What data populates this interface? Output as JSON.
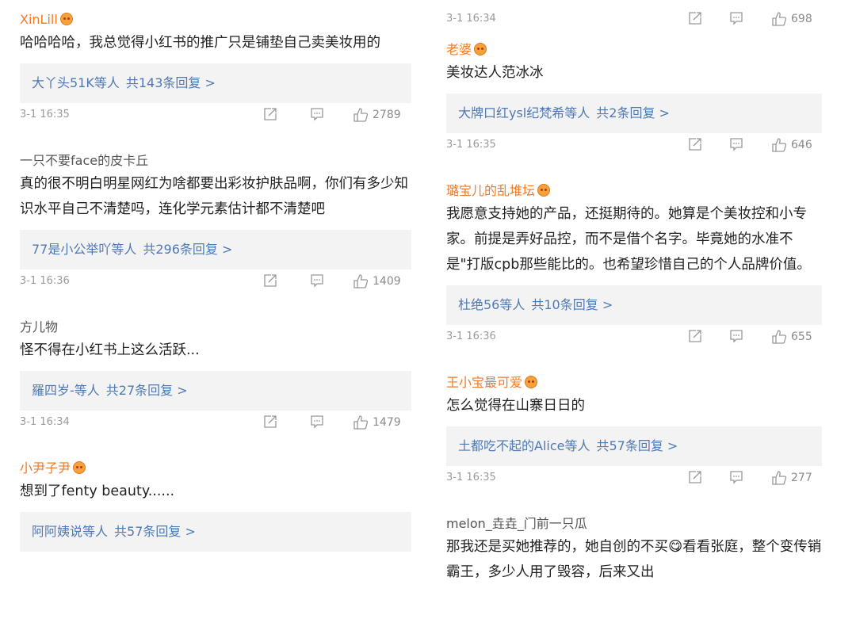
{
  "left": [
    {
      "user": "XinLill",
      "vip": true,
      "text": "哈哈哈哈，我总觉得小红书的推广只是铺垫自己卖美妆用的",
      "reply_names": "大丫头51K等人",
      "reply_count": "共143条回复 >",
      "time": "3-1 16:35",
      "likes": "2789"
    },
    {
      "user": "一只不要face的皮卡丘",
      "vip": false,
      "text": "真的很不明白明星网红为啥都要出彩妆护肤品啊，你们有多少知识水平自己不清楚吗，连化学元素估计都不清楚吧",
      "reply_names": "77是小公举吖等人",
      "reply_count": "共296条回复 >",
      "time": "3-1 16:36",
      "likes": "1409"
    },
    {
      "user": "方儿物",
      "vip": false,
      "text": "怪不得在小红书上这么活跃...",
      "reply_names": "羅四岁-等人",
      "reply_count": "共27条回复 >",
      "time": "3-1 16:34",
      "likes": "1479"
    },
    {
      "user": "小尹子尹",
      "vip": true,
      "text": "想到了fenty beauty......",
      "reply_names": "阿阿姨说等人",
      "reply_count": "共57条回复 >",
      "time": "",
      "likes": ""
    }
  ],
  "right_top": {
    "time": "3-1 16:34",
    "likes": "698"
  },
  "right": [
    {
      "user": "老婆",
      "vip": true,
      "text": "美妆达人范冰冰",
      "reply_names": "大牌口红ysl纪梵希等人",
      "reply_count": "共2条回复 >",
      "time": "3-1 16:35",
      "likes": "646"
    },
    {
      "user": "璐宝儿的乱堆坛",
      "vip": true,
      "text": "我愿意支持她的产品，还挺期待的。她算是个美妆控和小专家。前提是弄好品控，而不是借个名字。毕竟她的水准不是\"打版cpb那些能比的。也希望珍惜自己的个人品牌价值。",
      "reply_names": "杜绝56等人",
      "reply_count": "共10条回复 >",
      "time": "3-1 16:36",
      "likes": "655"
    },
    {
      "user": "王小宝最可爱",
      "vip": true,
      "text": "怎么觉得在山寨日日的",
      "reply_names": "土都吃不起的Alice等人",
      "reply_count": "共57条回复 >",
      "time": "3-1 16:35",
      "likes": "277"
    },
    {
      "user": "melon_垚垚_门前一只瓜",
      "vip": false,
      "text_before_emoji": "那我还是买她推荐的，她自创的不买",
      "emoji": "😋",
      "text_after_emoji": "看看张庭，整个变传销霸王，多少人用了毁容，后来又出"
    }
  ]
}
